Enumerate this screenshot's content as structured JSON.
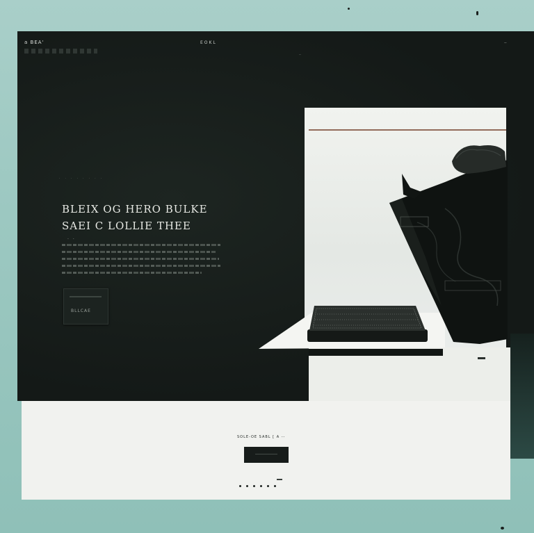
{
  "nav": {
    "logo": "a BEA'",
    "center_label": "EOKL",
    "links": [
      "",
      "",
      ""
    ],
    "right_label": "--",
    "subnav": [
      "",
      "",
      "",
      "",
      "",
      ""
    ],
    "small_line": "--"
  },
  "crumb": [
    "",
    ""
  ],
  "hero": {
    "eyebrow": ". . . . . . . .",
    "headline_line1": "BLEIX OG HERO BULKE",
    "headline_line2": "SAEI C LOLLIE THEE",
    "dots": ". .",
    "cta_label": "BLLCAE"
  },
  "lower": {
    "title": "SOLE-OE SABL  [ A --",
    "pager_count": 6
  },
  "colors": {
    "background": "#9cc8c1",
    "site_dark": "#161b19",
    "panel_light": "#f1f2ef",
    "accent_rule": "#7a4a35"
  },
  "icons": [
    "wallet-image",
    "leather-bag-image"
  ]
}
